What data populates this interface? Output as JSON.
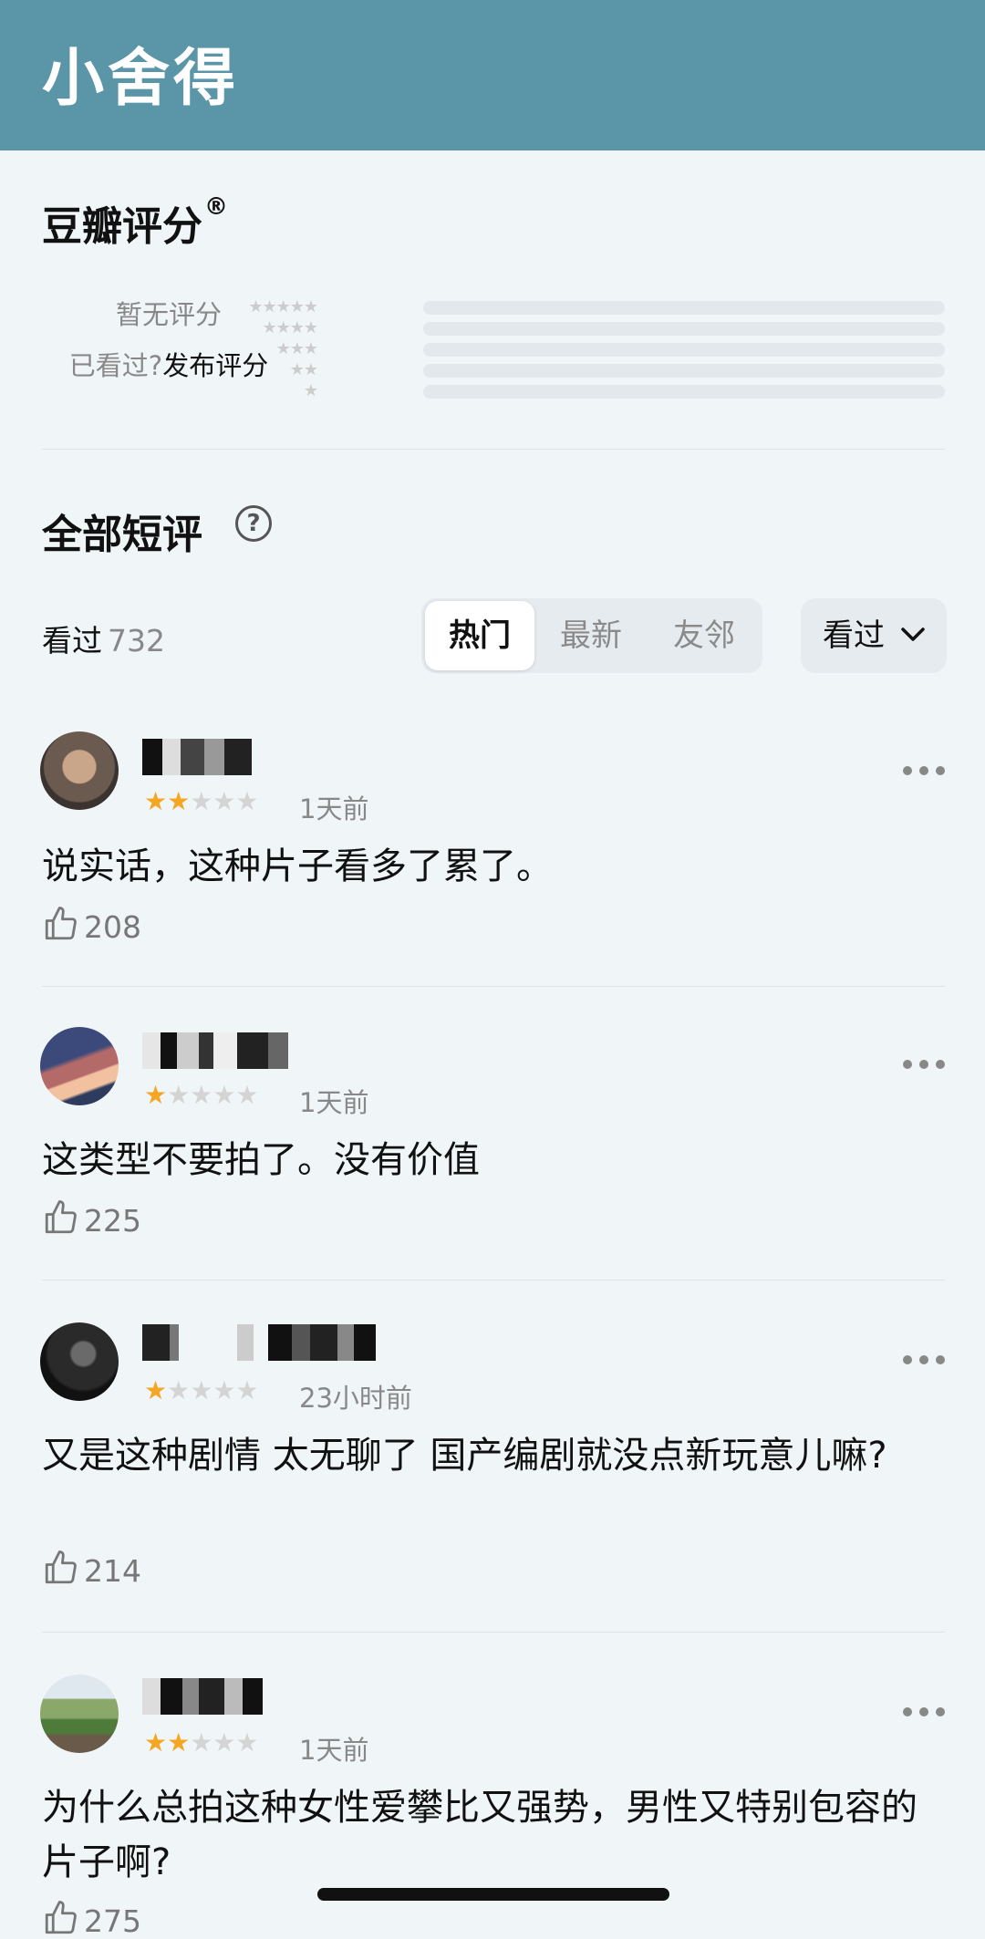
{
  "app_title": "小舍得",
  "rating_section": {
    "title": "豆瓣评分",
    "title_mark": "®",
    "no_rating": "暂无评分",
    "watched_prompt": "已看过?",
    "publish": "发布评分",
    "star_rows": [
      "★★★★★",
      "★★★★",
      "★★★",
      "★★",
      "★"
    ]
  },
  "short_reviews": {
    "title": "全部短评",
    "help_icon": "?",
    "watched_label": "看过",
    "watched_count": "732",
    "tabs": [
      "热门",
      "最新",
      "友邻"
    ],
    "active_tab": "热门",
    "filter_label": "看过",
    "filter_icon": "chevron-down-icon"
  },
  "comments": [
    {
      "stars": 2,
      "time": "1天前",
      "text": "说实话，这种片子看多了累了。",
      "likes": "208"
    },
    {
      "stars": 1,
      "time": "1天前",
      "text": "这类型不要拍了。没有价值",
      "likes": "225"
    },
    {
      "stars": 1,
      "time": "23小时前",
      "text": "又是这种剧情 太无聊了 国产编剧就没点新玩意儿嘛?",
      "likes": "214"
    },
    {
      "stars": 2,
      "time": "1天前",
      "text": "为什么总拍这种女性爱攀比又强势，男性又特别包容的片子啊?",
      "likes": "275"
    }
  ],
  "colors": {
    "appbar": "#5b95a8",
    "star_on": "#f5a623",
    "background": "#f0f5f8"
  }
}
